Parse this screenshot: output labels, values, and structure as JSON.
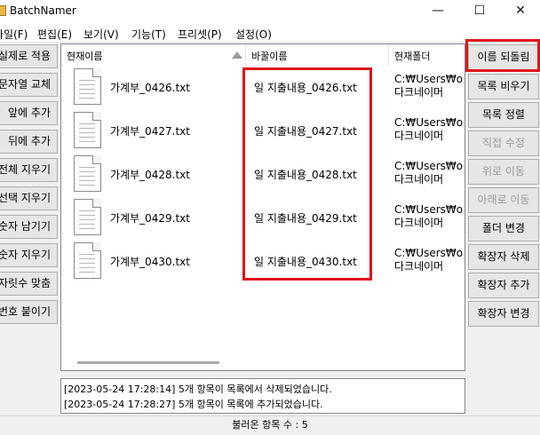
{
  "window": {
    "title": "BatchNamer",
    "minimize": "—",
    "maximize": "☐",
    "close": "✕"
  },
  "menu": [
    {
      "label": "파일(F)"
    },
    {
      "label": "편집(E)"
    },
    {
      "label": "보기(V)"
    },
    {
      "label": "기능(T)"
    },
    {
      "label": "프리셋(P)"
    },
    {
      "label": "설정(O)"
    }
  ],
  "left_buttons": [
    {
      "label": "실제로 적용"
    },
    {
      "label": "문자열 교체"
    },
    {
      "label": "앞에 추가"
    },
    {
      "label": "뒤에 추가"
    },
    {
      "label": "전체 지우기"
    },
    {
      "label": "선택 지우기"
    },
    {
      "label": "숫자 남기기"
    },
    {
      "label": "숫자 지우기"
    },
    {
      "label": "자릿수 맞춤"
    },
    {
      "label": "번호 붙이기"
    }
  ],
  "columns": {
    "current": "현재이름",
    "new": "바꿀이름",
    "folder": "현재폴더"
  },
  "rows": [
    {
      "current": "가계부_0426.txt",
      "new": "일 지출내용_0426.txt",
      "folder_line1": "C:₩Users₩o",
      "folder_line2": "다크네이머"
    },
    {
      "current": "가계부_0427.txt",
      "new": "일 지출내용_0427.txt",
      "folder_line1": "C:₩Users₩o",
      "folder_line2": "다크네이머"
    },
    {
      "current": "가계부_0428.txt",
      "new": "일 지출내용_0428.txt",
      "folder_line1": "C:₩Users₩o",
      "folder_line2": "다크네이머"
    },
    {
      "current": "가계부_0429.txt",
      "new": "일 지출내용_0429.txt",
      "folder_line1": "C:₩Users₩o",
      "folder_line2": "다크네이머"
    },
    {
      "current": "가계부_0430.txt",
      "new": "일 지출내용_0430.txt",
      "folder_line1": "C:₩Users₩o",
      "folder_line2": "다크네이머"
    }
  ],
  "right_buttons": [
    {
      "label": "이름 되돌림",
      "enabled": true
    },
    {
      "label": "목록 비우기",
      "enabled": true
    },
    {
      "label": "목록 정렬",
      "enabled": true
    },
    {
      "label": "직접 수정",
      "enabled": false
    },
    {
      "label": "위로 이동",
      "enabled": false
    },
    {
      "label": "아래로 이동",
      "enabled": false
    },
    {
      "label": "폴더 변경",
      "enabled": true
    },
    {
      "label": "확장자 삭제",
      "enabled": true
    },
    {
      "label": "확장자 추가",
      "enabled": true
    },
    {
      "label": "확장자 변경",
      "enabled": true
    }
  ],
  "log": [
    "[2023-05-24 17:28:14] 5개 항목이 목록에서 삭제되었습니다.",
    "[2023-05-24 17:28:27] 5개 항목이 목록에 추가되었습니다."
  ],
  "status": "불러온 항목 수 : 5",
  "colors": {
    "highlight": "#e0151c",
    "disabled_text": "#9b9b9b"
  }
}
